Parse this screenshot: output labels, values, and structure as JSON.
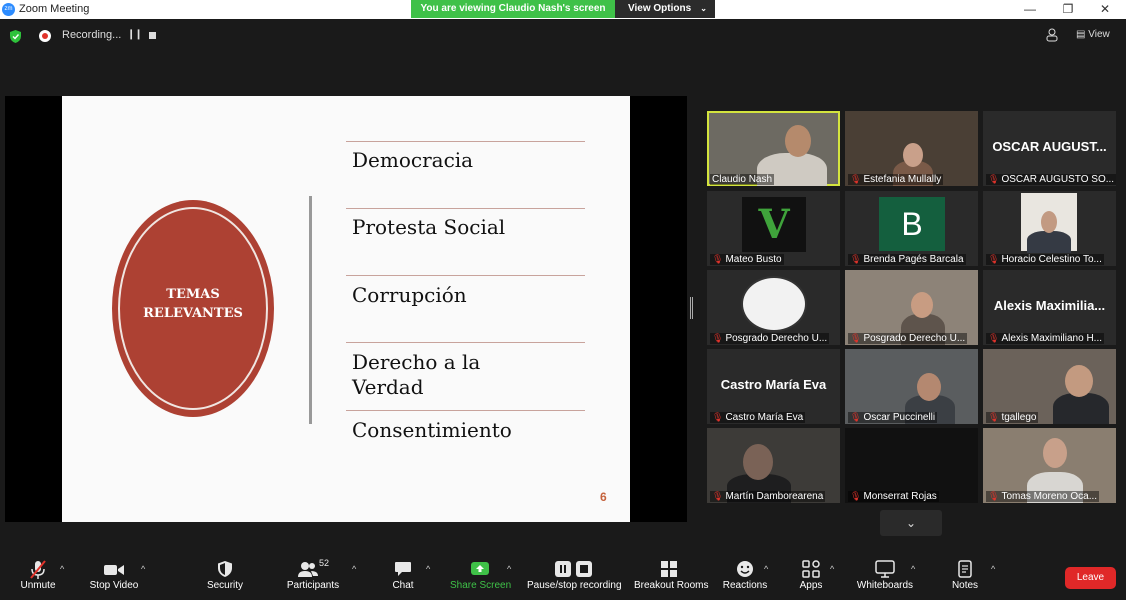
{
  "titlebar": {
    "title": "Zoom Meeting",
    "logo": "zm",
    "banner": "You are viewing Claudio Nash's screen",
    "view_options": "View Options"
  },
  "status": {
    "recording": "Recording...",
    "view": "View"
  },
  "slide": {
    "badge_line1": "TEMAS",
    "badge_line2": "RELEVANTES",
    "topics": [
      "Democracia",
      "Protesta Social",
      "Corrupción",
      "Derecho a la Verdad",
      "Consentimiento"
    ],
    "page": "6"
  },
  "participants": [
    "Claudio Nash",
    "Estefania Mullally",
    "OSCAR AUGUSTO SO...",
    "Mateo Busto",
    "Brenda Pagés Barcala",
    "Horacio Celestino To...",
    "Posgrado Derecho U...",
    "Posgrado Derecho U...",
    "Alexis Maximiliano H...",
    "Castro María Eva",
    "Oscar Puccinelli",
    "tgallego",
    "Martín Damborearena",
    "Monserrat Rojas",
    "Tomas Moreno Oca..."
  ],
  "tile_text": {
    "oscar": "OSCAR AUGUST...",
    "brenda_letter": "B",
    "alexis": "Alexis Maximilia...",
    "castro": "Castro María Eva"
  },
  "toolbar": {
    "unmute": "Unmute",
    "stop_video": "Stop Video",
    "security": "Security",
    "participants": "Participants",
    "participants_count": "52",
    "chat": "Chat",
    "share_screen": "Share Screen",
    "pause_recording": "Pause/stop recording",
    "breakout": "Breakout Rooms",
    "reactions": "Reactions",
    "apps": "Apps",
    "whiteboards": "Whiteboards",
    "notes": "Notes",
    "leave": "Leave"
  },
  "colors": {
    "banner": "#3fc148",
    "leave": "#e02828",
    "active_speaker": "#d4e43e",
    "slide_badge": "#ad4133"
  }
}
